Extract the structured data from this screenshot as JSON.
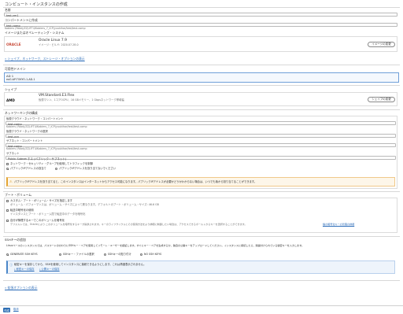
{
  "page": {
    "title": "コンピュート・インスタンスの作成"
  },
  "name_section": {
    "label": "名前",
    "value": "test-vm1"
  },
  "compartment": {
    "label": "コンパートメントに作成",
    "value": "test-comp",
    "path": "Kobiers (Root)/ZZJ-IFT4/Kobiers_7_ICP(yuukihar/test/test-comp"
  },
  "image": {
    "label": "イメージまたはオペレーティング・システム",
    "brand": "ORACLE",
    "name": "Oracle Linux 7.9",
    "build": "イメージ・ビルド: 2020.07.28-0",
    "change_button": "イメージの変更",
    "advanced_link": "シェイプ、ネットワーク、ストレージ・オプションの表示"
  },
  "availability_domain": {
    "label": "可用性ドメイン",
    "ad": "AD 1",
    "ad_name": "eoG:AP-TOKYO-1-AD-1"
  },
  "shape": {
    "label": "シェイプ",
    "brand": "AMD",
    "name": "VM.Standard.E3.Flex",
    "detail": "仮想マシン、1コアOCPU、16 GBメモリー、1 Gbpsネットワーク帯域幅",
    "change_button": "シェイプの変更"
  },
  "network": {
    "label": "ネットワーキングの構成",
    "vcn_compartment_label": "仮想クラウド・ネットワーク・コンパートメント",
    "vcn_compartment_value": "test-comp",
    "vcn_compartment_path": "Kobiers (Root)/ZZJ-IFT4/Kobiers_7_ICP(yuukihar/test/test-comp",
    "vcn_label": "仮想クラウド・ネットワークの選択",
    "vcn_value": "test-vcn",
    "subnet_compartment_label": "サブネット・コンパートメント",
    "subnet_compartment_value": "test-comp",
    "subnet_compartment_path": "Kobiers (Root)/ZZJ-IFT4/Kobiers_7_ICP(yuukihar/test/test-comp",
    "subnet_label": "サブネット",
    "subnet_value": "Public Subnet ホス (パブリック・サブネット)",
    "radio_nsg": "ネットワーク・セキュリティ・グループを使用してトラフィックを制御",
    "radio_public_ip": "パブリックIPアドレスの割当て",
    "radio_no_public_ip": "パブリックIPアドレスを割り当てないでください",
    "warning": "パブリックIPアドレスを割り当てると、このインスタンスはインターネットからアクセス可能になります。パブリックIPアドレスが必要かどうかわからない場合は、いつでも後から割り当てることができます。"
  },
  "boot_volume": {
    "label": "ブート・ボリューム",
    "opt1_title": "カスタム・ブート・ボリューム・サイズを指定します",
    "opt1_desc": "ボリューム・パフォーマンスは、ボリューム・サイズによって異なります。デフォルトのブート・ボリューム・サイズ: 46.6 GB",
    "opt2_title": "転送中暗号化の使用",
    "opt2_desc": "インスタンスとブート・ボリューム間で転送中のデータを暗号化",
    "opt3_title": "自分が管理するキーでこのボリュームを暗号化",
    "opt3_desc": "デフォルトでは、Oracleにより このボリュームを暗号化するキーが提供されます。キーのライフサイクルとその使用方法をより詳細に制御したい場合は、アクセスできるボールトからキーを選択することができます。",
    "opt3_link": "鍵の暗号化キーの管理の詳細"
  },
  "ssh": {
    "label": "SSHキーの追加",
    "desc": "Linuxベースのインスタンスでは、パスワードのかわりにSSHキー・ペアを使用してリモート・ユーザーを認証します。すぐにキー・ペアを生成するか、独自の公開キーをアップロードしてください。インスタンスに接続したら、関連付けられている秘密キーを入力します。",
    "radio_generate": "GENERATE SSH KEYS",
    "radio_upload": "SSHキー・ファイルの選択",
    "radio_paste": "SSHキーの貼り付け",
    "radio_none": "NO SSH KEYS",
    "info": "秘密キーを保存してから、SSHを使用してインスタンスに接続できるようにします。これは再度表示されません。",
    "info_save_private": "秘密キーの保存",
    "info_save_public": "公開キーの保存"
  },
  "footer": {
    "advanced_link": "拡張オプションの表示",
    "create_button": "作成",
    "cancel_link": "取消"
  }
}
